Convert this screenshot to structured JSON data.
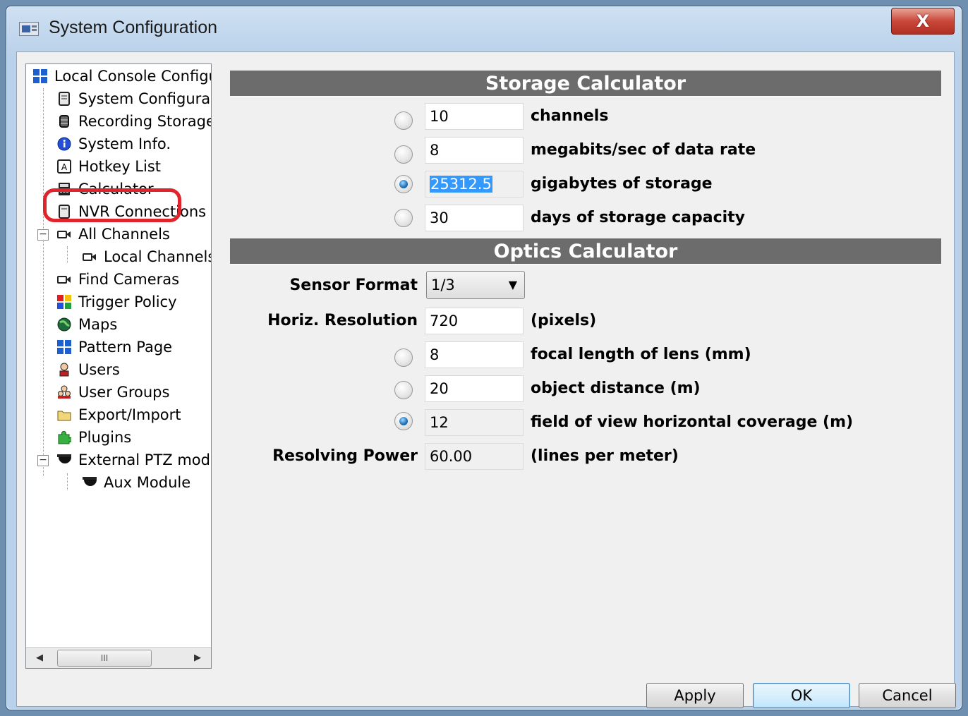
{
  "window": {
    "title": "System Configuration",
    "close_label": "X"
  },
  "tree": {
    "items": [
      {
        "label": "Local Console Configu",
        "icon": "grid-blue-icon"
      },
      {
        "label": "System Configura",
        "icon": "server-icon"
      },
      {
        "label": "Recording Storage",
        "icon": "database-icon"
      },
      {
        "label": "System Info.",
        "icon": "info-icon"
      },
      {
        "label": "Hotkey List",
        "icon": "keyboard-key-icon"
      },
      {
        "label": "Calculator",
        "icon": "calculator-icon"
      },
      {
        "label": "NVR Connections",
        "icon": "server-icon"
      },
      {
        "label": "All Channels",
        "icon": "camera-icon"
      },
      {
        "label": "Local Channels",
        "icon": "camera-icon"
      },
      {
        "label": "Find Cameras",
        "icon": "camera-icon"
      },
      {
        "label": "Trigger Policy",
        "icon": "color-grid-icon"
      },
      {
        "label": "Maps",
        "icon": "globe-icon"
      },
      {
        "label": "Pattern Page",
        "icon": "grid-blue-icon"
      },
      {
        "label": "Users",
        "icon": "user-icon"
      },
      {
        "label": "User Groups",
        "icon": "users-icon"
      },
      {
        "label": "Export/Import",
        "icon": "folder-icon"
      },
      {
        "label": "Plugins",
        "icon": "puzzle-icon"
      },
      {
        "label": "External PTZ mod",
        "icon": "dome-camera-icon"
      },
      {
        "label": "Aux Module",
        "icon": "dome-camera-icon"
      }
    ],
    "scroll_thumb": "III"
  },
  "storage": {
    "header": "Storage Calculator",
    "rows": [
      {
        "value": "10",
        "label": "channels",
        "selected": false
      },
      {
        "value": "8",
        "label": "megabits/sec of data rate",
        "selected": false
      },
      {
        "value": "25312.5",
        "label": "gigabytes of storage",
        "selected": true
      },
      {
        "value": "30",
        "label": "days of storage capacity",
        "selected": false
      }
    ]
  },
  "optics": {
    "header": "Optics Calculator",
    "sensor_format_label": "Sensor Format",
    "sensor_format_value": "1/3",
    "horiz_res_label": "Horiz. Resolution",
    "horiz_res_value": "720",
    "horiz_res_unit": "(pixels)",
    "rows": [
      {
        "value": "8",
        "label": "focal length of lens (mm)",
        "selected": false
      },
      {
        "value": "20",
        "label": "object distance (m)",
        "selected": false
      },
      {
        "value": "12",
        "label": "field of view horizontal coverage (m)",
        "selected": true
      }
    ],
    "resolving_label": "Resolving Power",
    "resolving_value": "60.00",
    "resolving_unit": "(lines per meter)"
  },
  "buttons": {
    "apply": "Apply",
    "ok": "OK",
    "cancel": "Cancel"
  },
  "colors": {
    "section_header": "#6c6c6c",
    "highlight_ring": "#e0242c",
    "selection": "#3399ff"
  }
}
